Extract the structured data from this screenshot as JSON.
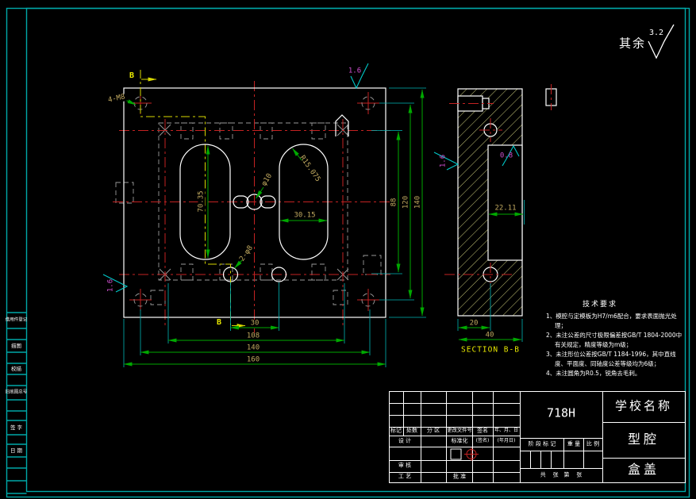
{
  "surface_note": {
    "prefix": "其余",
    "roughness": "3.2"
  },
  "plan_view": {
    "thread_callout": "4-M8",
    "pin_callout": "2-φ8",
    "center_hole": "φ10",
    "slot_radius": "R15.075",
    "slot_length": "70.35",
    "slot_width": "30.15",
    "section_label_top": "B",
    "section_label_bottom": "B",
    "dims_bottom": [
      "30",
      "108",
      "140",
      "160"
    ],
    "dims_right": [
      "88",
      "120",
      "140"
    ],
    "roughness_top": "1.6",
    "roughness_left": "1.6"
  },
  "section_view": {
    "caption": "SECTION B-B",
    "cavity_width": "22.11",
    "dim_20": "20",
    "dim_40": "40",
    "roughness_left": "1.6",
    "roughness_cavity": "0.8"
  },
  "tech_notes": {
    "title": "技术要求",
    "items": [
      "1、模腔与定模板为H7/m6配合，要求表面抛光处理；",
      "2、未注公差的尺寸极限偏差按GB/T 1804-2000中有关规定，精度等级为m级；",
      "3、未注形位公差按GB/T 1184-1996，其中直线度、平面度、同轴度公差等级均为6级；",
      "4、未注圆角为R0.5，锐角去毛刺。"
    ]
  },
  "title_block": {
    "material": "718H",
    "school": "学校名称",
    "part_name": "型腔",
    "product_name": "盒盖",
    "rev_headers": [
      "标记",
      "处数",
      "分 区",
      "更改文件号",
      "签名",
      "年、月、日"
    ],
    "roles": {
      "design": "设 计",
      "standard": "标准化",
      "sign": "(签名)",
      "date": "(年月日)",
      "check": "审 核",
      "process": "工 艺",
      "approve": "批 准"
    },
    "stage_headers": [
      "阶 段 标 记",
      "重 量",
      "比 例"
    ],
    "sheet": "共    张   第    张"
  },
  "margin_strip": {
    "labels": [
      "借用件登记",
      "描图",
      "校描",
      "旧底图总号",
      "签 字",
      "日 期"
    ]
  },
  "colors": {
    "background": "#000000",
    "outline": "#ffffff",
    "centerline": "#c42222",
    "hidden_line": "#9a9a9a",
    "cutting_line": "#d8d800",
    "dimension_line": "#00a800",
    "dimension_text": "#c2aa60",
    "extension_line": "#00b6b6",
    "roughness_text": "#d050d0",
    "hatch": "#c8c878",
    "frame": "#00a8a8"
  }
}
